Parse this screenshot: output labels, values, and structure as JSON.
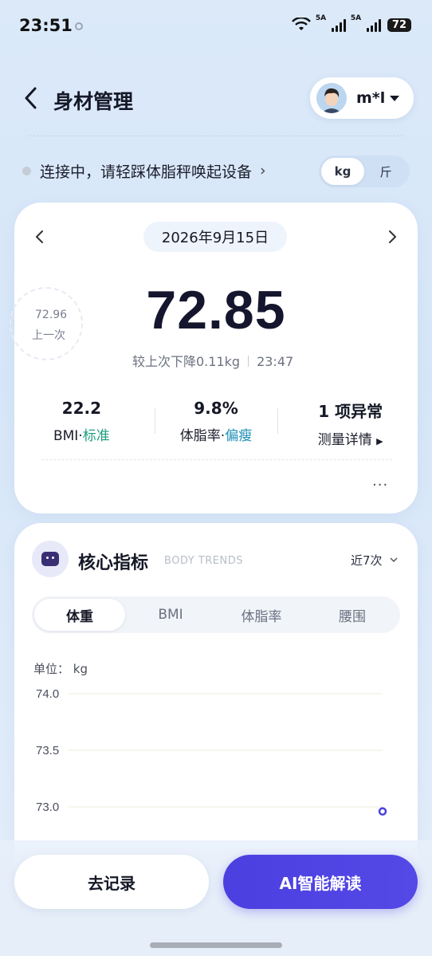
{
  "status_bar": {
    "time": "23:51",
    "net1": "5A",
    "net2": "5A",
    "battery": "72"
  },
  "header": {
    "title": "身材管理",
    "user_name": "m*l"
  },
  "connection": {
    "text": "连接中，请轻踩体脂秤唤起设备",
    "arrow": "›"
  },
  "units": {
    "options": [
      "kg",
      "斤"
    ],
    "selected": "kg"
  },
  "weight_card": {
    "date": "2026年9月15日",
    "previous_value": "72.96",
    "previous_label": "上一次",
    "current_weight": "72.85",
    "change_text": "较上次下降0.11kg",
    "time": "23:47",
    "stats": [
      {
        "value": "22.2",
        "label": "BMI",
        "status": "标准",
        "status_color": "#1e9e7e"
      },
      {
        "value": "9.8%",
        "label": "体脂率",
        "status": "偏瘦",
        "status_color": "#1c8fb5"
      },
      {
        "value": "1 项异常",
        "label": "测量详情",
        "link_color": "#2d57b8"
      }
    ],
    "more": "···"
  },
  "core": {
    "title": "核心指标",
    "subtitle": "BODY TRENDS",
    "range": "近7次",
    "tabs": [
      "体重",
      "BMI",
      "体脂率",
      "腰围"
    ],
    "active_tab": "体重",
    "unit_label": "单位：  kg"
  },
  "chart_data": {
    "type": "line",
    "title": "",
    "xlabel": "",
    "ylabel": "单位：  kg",
    "yticks": [
      "74.0",
      "73.5",
      "73.0"
    ],
    "ylim": [
      72.85,
      74.1
    ],
    "series": [
      {
        "values": [
          72.96
        ]
      }
    ]
  },
  "actions": {
    "record": "去记录",
    "ai": "AI智能解读"
  },
  "colors": {
    "accent": "#4b3fe0",
    "background": "#dbe9f9"
  }
}
